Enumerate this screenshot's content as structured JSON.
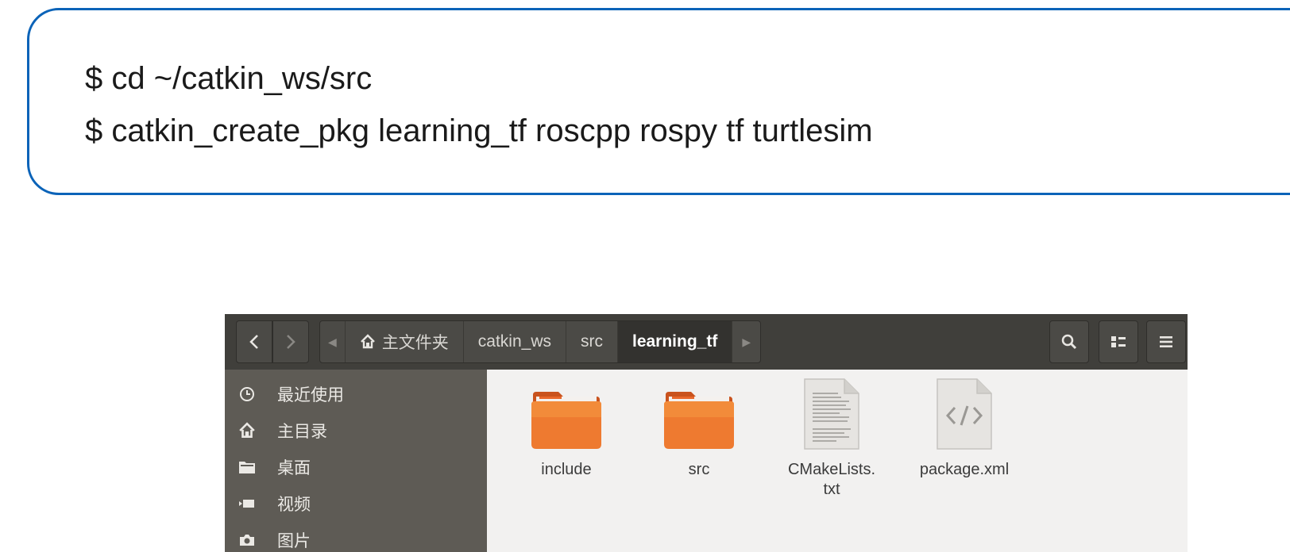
{
  "terminal": {
    "line1": "$ cd ~/catkin_ws/src",
    "line2": "$ catkin_create_pkg learning_tf roscpp rospy tf turtlesim"
  },
  "file_manager": {
    "breadcrumbs": {
      "home_label": "主文件夹",
      "items": [
        "catkin_ws",
        "src",
        "learning_tf"
      ],
      "active": "learning_tf"
    },
    "toolbar_icons": [
      "back-icon",
      "forward-icon",
      "search-icon",
      "view-list-icon",
      "hamburger-menu-icon"
    ],
    "sidebar": {
      "items": [
        {
          "label": "最近使用",
          "icon": "recent-clock-icon"
        },
        {
          "label": "主目录",
          "icon": "home-icon"
        },
        {
          "label": "桌面",
          "icon": "desktop-folder-icon"
        },
        {
          "label": "视频",
          "icon": "video-icon"
        },
        {
          "label": "图片",
          "icon": "camera-icon"
        }
      ]
    },
    "files": [
      {
        "name": "include",
        "type": "folder"
      },
      {
        "name": "src",
        "type": "folder"
      },
      {
        "name": "CMakeLists.\ntxt",
        "type": "text"
      },
      {
        "name": "package.xml",
        "type": "xml"
      }
    ],
    "colors": {
      "header": "#403f3b",
      "sidebar": "#5e5b55",
      "content": "#f2f1f0",
      "folder_orange": "#e8672a",
      "accent_border": "#0b63b8"
    }
  }
}
